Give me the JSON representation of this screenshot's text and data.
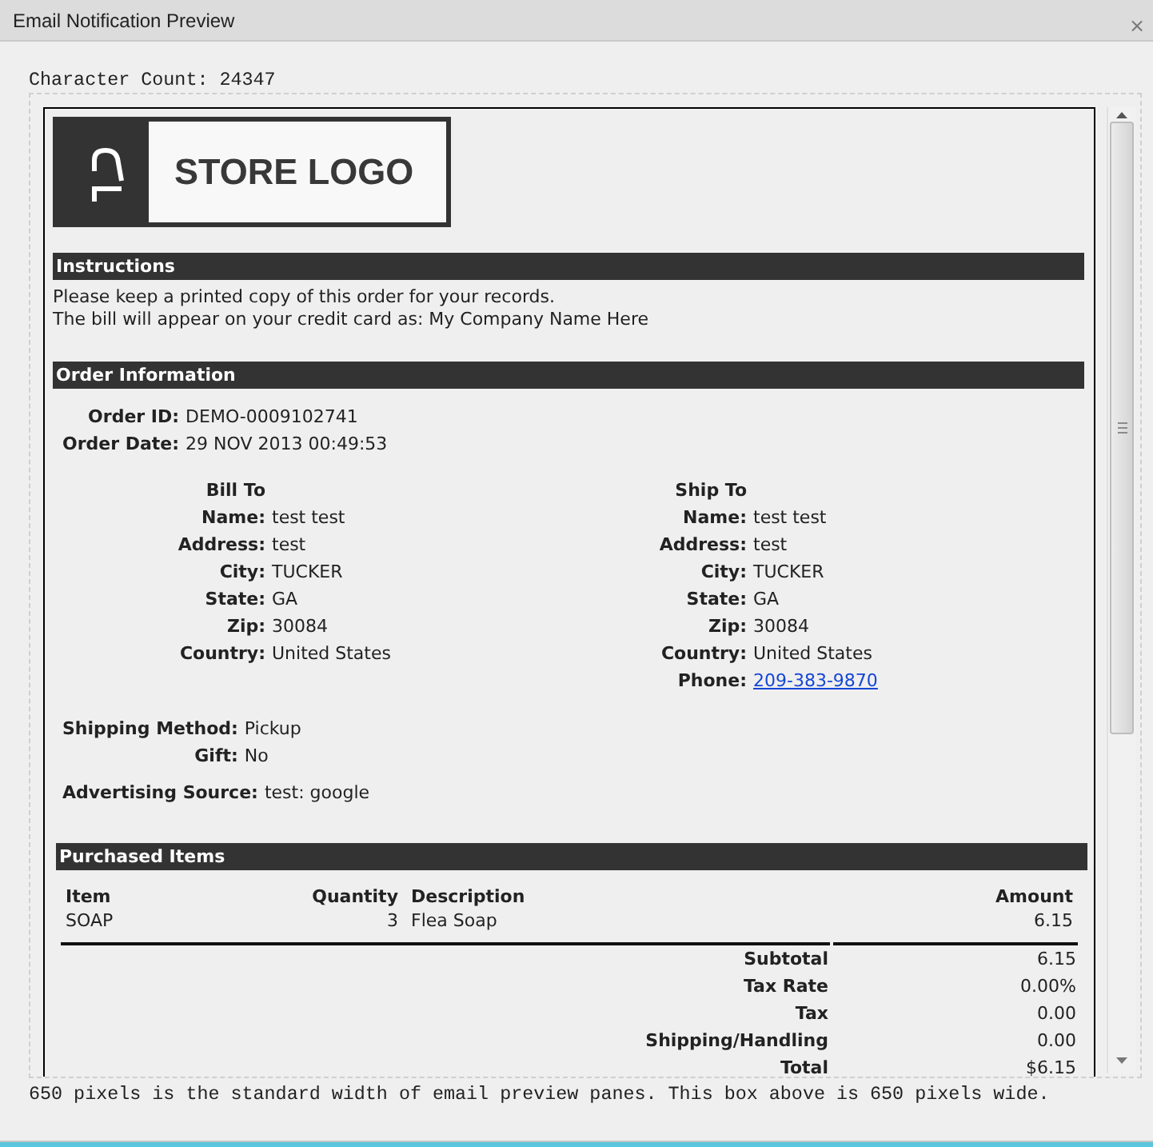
{
  "window": {
    "title": "Email Notification Preview",
    "close": "×"
  },
  "character_count": "Character Count: 24347",
  "email": {
    "logo": {
      "text": "STORE LOGO"
    },
    "instructions": {
      "heading": "Instructions",
      "lines": [
        "Please keep a printed copy of this order for your records.",
        "The bill will appear on your credit card as: My Company Name Here"
      ]
    },
    "order_information": {
      "heading": "Order Information",
      "fields": [
        {
          "label": "Order ID:",
          "value": "DEMO-0009102741"
        },
        {
          "label": "Order Date:",
          "value": "29 NOV 2013 00:49:53"
        }
      ],
      "addresses": [
        {
          "heading": "Bill To",
          "fields": [
            {
              "label": "Name:",
              "value": "test test",
              "kind": "text"
            },
            {
              "label": "Address:",
              "value": "test",
              "kind": "text"
            },
            {
              "label": "City:",
              "value": "TUCKER",
              "kind": "text"
            },
            {
              "label": "State:",
              "value": "GA",
              "kind": "text"
            },
            {
              "label": "Zip:",
              "value": "30084",
              "kind": "text"
            },
            {
              "label": "Country:",
              "value": "United States",
              "kind": "text"
            }
          ]
        },
        {
          "heading": "Ship To",
          "fields": [
            {
              "label": "Name:",
              "value": "test test",
              "kind": "text"
            },
            {
              "label": "Address:",
              "value": "test",
              "kind": "text"
            },
            {
              "label": "City:",
              "value": "TUCKER",
              "kind": "text"
            },
            {
              "label": "State:",
              "value": "GA",
              "kind": "text"
            },
            {
              "label": "Zip:",
              "value": "30084",
              "kind": "text"
            },
            {
              "label": "Country:",
              "value": "United States",
              "kind": "text"
            },
            {
              "label": "Phone:",
              "value": "209-383-9870",
              "kind": "link"
            }
          ]
        }
      ],
      "shipping_fields": [
        {
          "label": "Shipping Method:",
          "value": "Pickup"
        },
        {
          "label": "Gift:",
          "value": "No"
        }
      ],
      "advertising": {
        "label": "Advertising Source:",
        "value": "test: google"
      }
    },
    "purchased_items": {
      "heading": "Purchased Items",
      "columns": [
        "Item",
        "Quantity",
        "Description",
        "Amount"
      ],
      "rows": [
        {
          "item": "SOAP",
          "quantity": "3",
          "description": "Flea Soap",
          "amount": "6.15"
        }
      ],
      "totals": [
        {
          "label": "Subtotal",
          "value": "6.15"
        },
        {
          "label": "Tax Rate",
          "value": "0.00%"
        },
        {
          "label": "Tax",
          "value": "0.00"
        },
        {
          "label": "Shipping/Handling",
          "value": "0.00"
        },
        {
          "label": "Total",
          "value": "$6.15"
        }
      ]
    }
  },
  "footer_note": "650 pixels is the standard width of email preview panes. This box above is 650 pixels wide."
}
